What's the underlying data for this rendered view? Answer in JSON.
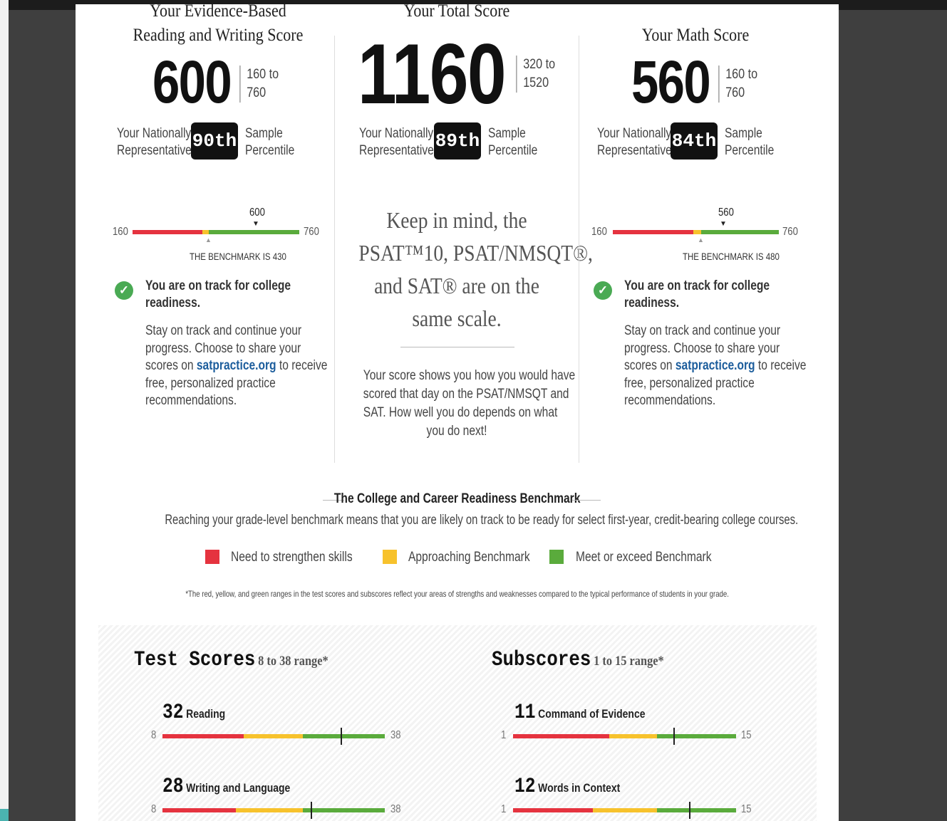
{
  "columns": [
    {
      "heading_top": "Your Evidence-Based",
      "heading_bottom": "Reading and Writing Score",
      "score": "600",
      "range_top": "160 to",
      "range_bottom": "760",
      "percentile_left_1": "Your Nationally",
      "percentile_left_2": "Representative",
      "percentile": "90th",
      "percentile_right_1": "Sample",
      "percentile_right_2": "Percentile",
      "bar_min": "160",
      "bar_max": "760",
      "marker_value": "600",
      "benchmark_text": "THE BENCHMARK IS 430",
      "track_title_1": "You are on track for college",
      "track_title_2": "readiness.",
      "track_body_1": "Stay on track and continue your",
      "track_body_2": "progress. Choose to share your",
      "track_body_3_pre": "scores on ",
      "track_body_3_link": "satpractice.org",
      "track_body_3_post": " to receive",
      "track_body_4": "free, personalized practice",
      "track_body_5": "recommendations."
    },
    {
      "heading_top": "Your Total Score",
      "score": "1160",
      "range_top": "320 to",
      "range_bottom": "1520",
      "percentile_left_1": "Your Nationally",
      "percentile_left_2": "Representative",
      "percentile": "89th",
      "percentile_right_1": "Sample",
      "percentile_right_2": "Percentile",
      "note_1": "Keep in mind, the",
      "note_2": "PSAT™10, PSAT/NMSQT®,",
      "note_3": "and SAT® are on the",
      "note_4": "same scale.",
      "explain_1": "Your score shows you how you would have",
      "explain_2": "scored that day on the PSAT/NMSQT and",
      "explain_3": "SAT. How well you do depends on what",
      "explain_4": "you do next!"
    },
    {
      "heading_top": "Your Math Score",
      "score": "560",
      "range_top": "160 to",
      "range_bottom": "760",
      "percentile_left_1": "Your Nationally",
      "percentile_left_2": "Representative",
      "percentile": "84th",
      "percentile_right_1": "Sample",
      "percentile_right_2": "Percentile",
      "bar_min": "160",
      "bar_max": "760",
      "marker_value": "560",
      "benchmark_text": "THE BENCHMARK IS 480",
      "track_title_1": "You are on track for college",
      "track_title_2": "readiness.",
      "track_body_1": "Stay on track and continue your",
      "track_body_2": "progress. Choose to share your",
      "track_body_3_pre": "scores on ",
      "track_body_3_link": "satpractice.org",
      "track_body_3_post": " to receive",
      "track_body_4": "free, personalized practice",
      "track_body_5": "recommendations."
    }
  ],
  "benchmark_section": {
    "title": "The College and Career Readiness Benchmark",
    "description": "Reaching your grade-level benchmark means that you are likely on track to be ready for select first-year, credit-bearing college courses.",
    "legend": [
      {
        "label": "Need to strengthen skills",
        "color": "#e5333f"
      },
      {
        "label": "Approaching Benchmark",
        "color": "#f7c22c"
      },
      {
        "label": "Meet or exceed Benchmark",
        "color": "#5aab3c"
      }
    ],
    "footnote": "*The red, yellow, and green ranges in the test scores and subscores reflect your areas of strengths and weaknesses compared to the typical performance of students in your grade."
  },
  "test_scores": {
    "title": "Test Scores",
    "range_note": "8 to 38 range*",
    "items": [
      {
        "score": "32",
        "name": "Reading",
        "min": "8",
        "max": "38",
        "value": 32
      },
      {
        "score": "28",
        "name": "Writing and Language",
        "min": "8",
        "max": "38",
        "value": 28
      }
    ]
  },
  "subscores": {
    "title": "Subscores",
    "range_note": "1 to 15 range*",
    "items": [
      {
        "score": "11",
        "name": "Command of Evidence",
        "min": "1",
        "max": "15",
        "value": 11
      },
      {
        "score": "12",
        "name": "Words in Context",
        "min": "1",
        "max": "15",
        "value": 12
      }
    ]
  }
}
